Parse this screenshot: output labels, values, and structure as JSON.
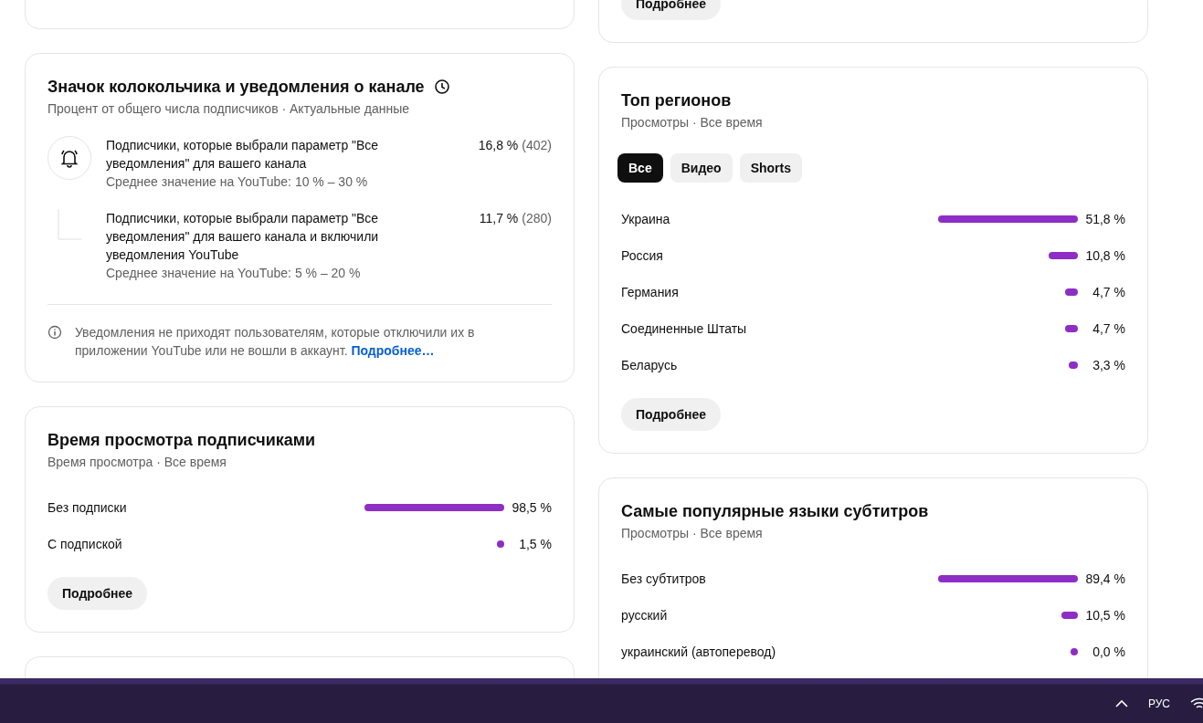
{
  "top_right_card": {
    "button": "Подробнее"
  },
  "bell_card": {
    "title": "Значок колокольчика и уведомления о канале",
    "subtitle": "Процент от общего числа подписчиков · Актуальные данные",
    "items": [
      {
        "kind": "bell",
        "text": "Подписчики, которые выбрали параметр \"Все уведомления\" для вашего канала",
        "average": "Среднее значение на YouTube: 10 % – 30 %",
        "percent": "16,8 %",
        "count": "(402)"
      },
      {
        "kind": "branch",
        "text": "Подписчики, которые выбрали параметр \"Все уведомления\" для вашего канала и включили уведомления YouTube",
        "average": "Среднее значение на YouTube: 5 % – 20 %",
        "percent": "11,7 %",
        "count": "(280)"
      }
    ],
    "note": "Уведомления не приходят пользователям, которые отключили их в приложении YouTube или не вошли в аккаунт.",
    "note_link": "Подробнее…"
  },
  "watch_card": {
    "title": "Время просмотра подписчиками",
    "subtitle": "Время просмотра · Все время",
    "rows": [
      {
        "label": "Без подписки",
        "value": "98,5 %"
      },
      {
        "label": "С подпиской",
        "value": "1,5 %"
      }
    ],
    "button": "Подробнее"
  },
  "regions_card": {
    "title": "Топ регионов",
    "subtitle": "Просмотры · Все время",
    "chips": [
      {
        "label": "Все",
        "selected": true
      },
      {
        "label": "Видео",
        "selected": false
      },
      {
        "label": "Shorts",
        "selected": false
      }
    ],
    "rows": [
      {
        "label": "Украина",
        "value": "51,8 %"
      },
      {
        "label": "Россия",
        "value": "10,8 %"
      },
      {
        "label": "Германия",
        "value": "4,7 %"
      },
      {
        "label": "Соединенные Штаты",
        "value": "4,7 %"
      },
      {
        "label": "Беларусь",
        "value": "3,3 %"
      }
    ],
    "button": "Подробнее"
  },
  "subtitles_card": {
    "title": "Самые популярные языки субтитров",
    "subtitle": "Просмотры · Все время",
    "rows": [
      {
        "label": "Без субтитров",
        "value": "89,4 %"
      },
      {
        "label": "русский",
        "value": "10,5 %"
      },
      {
        "label": "украинский (автоперевод)",
        "value": "0,0 %"
      }
    ]
  },
  "taskbar": {
    "language": "РУС"
  }
}
